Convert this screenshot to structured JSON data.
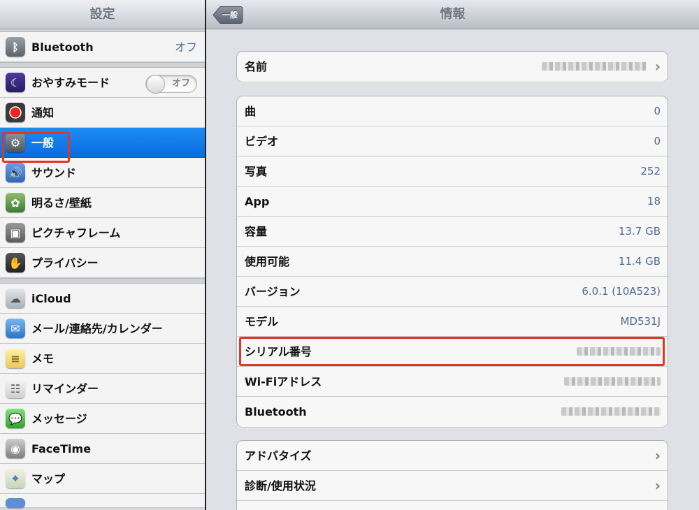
{
  "sidebar": {
    "title": "設定",
    "items": [
      {
        "label": "Bluetooth",
        "value": "オフ",
        "icon": "bluetooth-icon"
      },
      {
        "label": "おやすみモード",
        "toggle": "オフ",
        "icon": "moon-icon"
      },
      {
        "label": "通知",
        "icon": "notification-icon"
      },
      {
        "label": "一般",
        "icon": "gear-icon",
        "selected": true
      },
      {
        "label": "サウンド",
        "icon": "speaker-icon"
      },
      {
        "label": "明るさ/壁紙",
        "icon": "flower-icon"
      },
      {
        "label": "ピクチャフレーム",
        "icon": "picture-frame-icon"
      },
      {
        "label": "プライバシー",
        "icon": "hand-icon"
      },
      {
        "label": "iCloud",
        "icon": "cloud-icon"
      },
      {
        "label": "メール/連絡先/カレンダー",
        "icon": "mail-icon"
      },
      {
        "label": "メモ",
        "icon": "notes-icon"
      },
      {
        "label": "リマインダー",
        "icon": "reminders-icon"
      },
      {
        "label": "メッセージ",
        "icon": "messages-icon"
      },
      {
        "label": "FaceTime",
        "icon": "facetime-icon"
      },
      {
        "label": "マップ",
        "icon": "maps-icon"
      }
    ]
  },
  "detail": {
    "title": "情報",
    "back_label": "一般",
    "name_group": {
      "label": "名前"
    },
    "info_rows": [
      {
        "label": "曲",
        "value": "0"
      },
      {
        "label": "ビデオ",
        "value": "0"
      },
      {
        "label": "写真",
        "value": "252"
      },
      {
        "label": "App",
        "value": "18"
      },
      {
        "label": "容量",
        "value": "13.7 GB"
      },
      {
        "label": "使用可能",
        "value": "11.4 GB"
      },
      {
        "label": "バージョン",
        "value": "6.0.1 (10A523)"
      },
      {
        "label": "モデル",
        "value": "MD531J"
      },
      {
        "label": "シリアル番号",
        "value": ""
      },
      {
        "label": "Wi-Fiアドレス",
        "value": ""
      },
      {
        "label": "Bluetooth",
        "value": ""
      }
    ],
    "bottom_rows": [
      {
        "label": "アドバタイズ"
      },
      {
        "label": "診断/使用状況"
      }
    ]
  },
  "colors": {
    "accent_selected": "#0a6be0",
    "value_text": "#4d6a94",
    "highlight_box": "#e53420"
  }
}
